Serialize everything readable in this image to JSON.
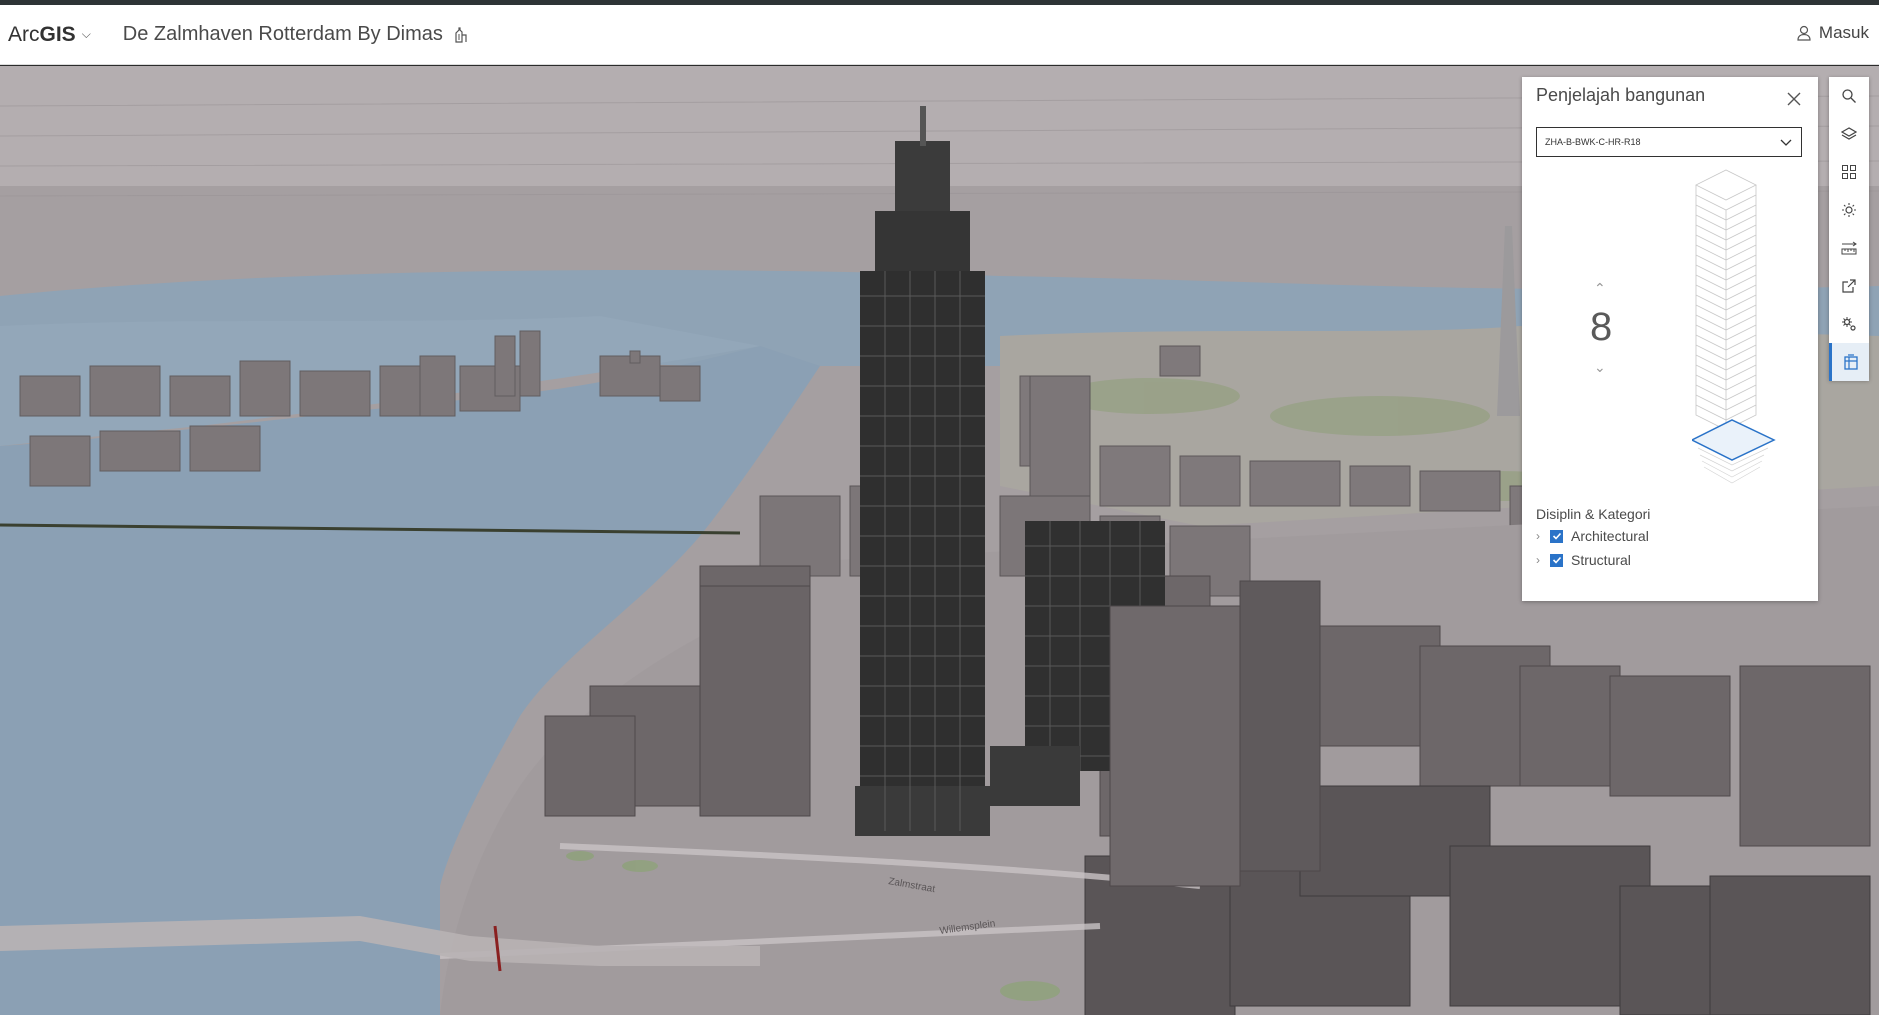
{
  "header": {
    "logo_prefix": "Arc",
    "logo_bold": "GIS",
    "title": "De Zalmhaven Rotterdam By Dimas",
    "signin_label": "Masuk"
  },
  "panel": {
    "title": "Penjelajah bangunan",
    "selected_building": "ZHA-B-BWK-C-HR-R18",
    "level": "8",
    "disciplines_title": "Disiplin & Kategori",
    "disciplines": [
      {
        "label": "Architectural",
        "checked": true
      },
      {
        "label": "Structural",
        "checked": true
      }
    ]
  },
  "map": {
    "street_labels": [
      "Zalmstraat",
      "Willemsplein"
    ]
  },
  "toolbar": {
    "tools": [
      "search-icon",
      "layers-icon",
      "basemap-icon",
      "daylight-icon",
      "measure-icon",
      "share-icon",
      "settings-icon",
      "building-explorer-icon"
    ],
    "active": "building-explorer-icon"
  },
  "colors": {
    "accent": "#2a73c8",
    "water": "#8fa4b8",
    "ground": "#a49d9f",
    "buildings": "#7b7577",
    "tower": "#2f2f2f"
  }
}
